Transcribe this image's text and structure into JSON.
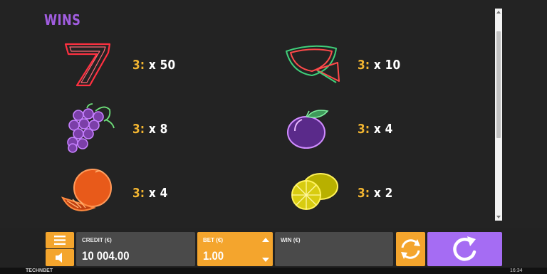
{
  "paytable": {
    "heading": "WINS",
    "symbols": [
      {
        "name": "seven",
        "count": "3:",
        "multiplier": "x 50"
      },
      {
        "name": "watermelon",
        "count": "3:",
        "multiplier": "x 10"
      },
      {
        "name": "grapes",
        "count": "3:",
        "multiplier": "x 8"
      },
      {
        "name": "plum",
        "count": "3:",
        "multiplier": "x 4"
      },
      {
        "name": "orange",
        "count": "3:",
        "multiplier": "x 4"
      },
      {
        "name": "lemon",
        "count": "3:",
        "multiplier": "x 2"
      }
    ]
  },
  "controls": {
    "menu_icon": "menu-icon",
    "sound_icon": "speaker-icon",
    "credit": {
      "label": "CREDIT (€)",
      "value": "10 004.00"
    },
    "bet": {
      "label": "BET (€)",
      "value": "1.00"
    },
    "win": {
      "label": "WIN (€)",
      "value": ""
    },
    "autoplay_icon": "autoplay-icon",
    "spin_icon": "spin-icon"
  },
  "footer": {
    "brand": "TECHNBET",
    "time": "16:34"
  },
  "colors": {
    "accent_orange": "#f4a52d",
    "spin_purple": "#a56cf3",
    "heading_purple": "#a15de0",
    "count_yellow": "#f2b531"
  }
}
